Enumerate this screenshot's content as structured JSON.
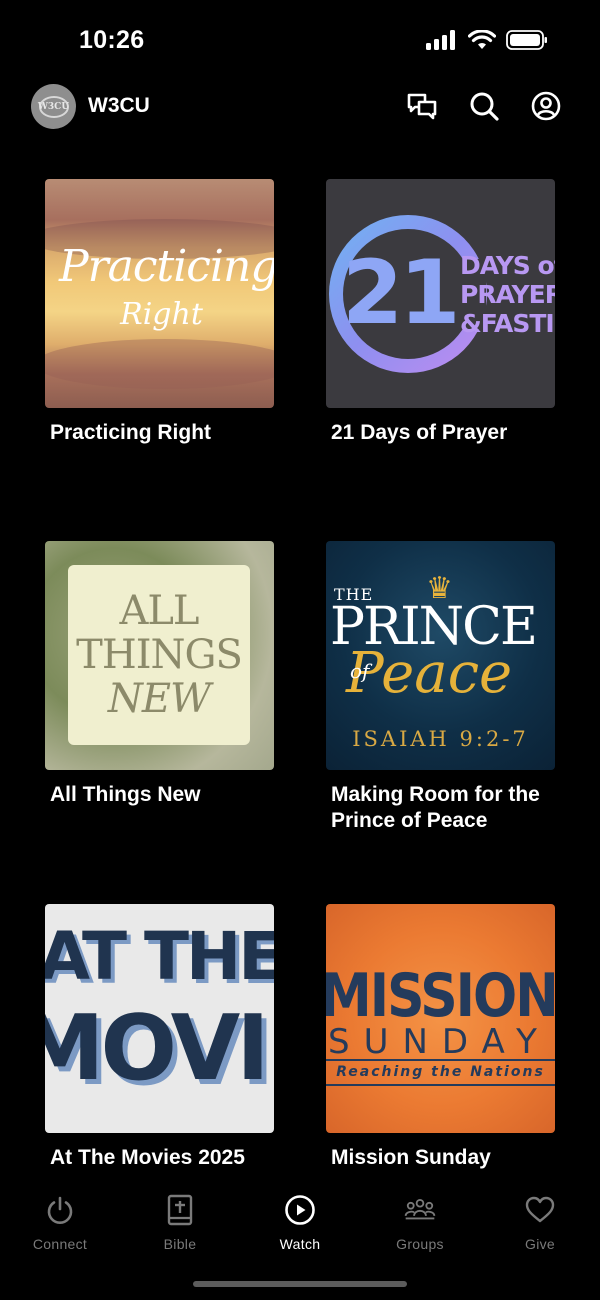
{
  "status_bar": {
    "time": "10:26"
  },
  "header": {
    "title": "W3CU",
    "avatar_text": "W3CU"
  },
  "series": [
    {
      "title": "Practicing Right",
      "art": {
        "line1": "Practicing",
        "line2": "Right"
      }
    },
    {
      "title": "21 Days of Prayer",
      "art": {
        "number": "21",
        "line1": "DAYS of",
        "line2": "PRAYER",
        "line3": "&FASTING"
      }
    },
    {
      "title": "All Things New",
      "art": {
        "line1": "ALL",
        "line2": "THINGS",
        "line3": "NEW"
      }
    },
    {
      "title": "Making Room for the Prince of Peace",
      "art": {
        "the": "THE",
        "prince": "PRINCE",
        "of": "of",
        "peace": "Peace",
        "ref": "ISAIAH 9:2-7"
      }
    },
    {
      "title": "At The Movies 2025",
      "art": {
        "line1": "AT THE",
        "line2": "MOVIES"
      }
    },
    {
      "title": "Mission Sunday",
      "art": {
        "line1": "MISSIONS",
        "line2": "SUNDAY",
        "line3": "Reaching the Nations"
      }
    }
  ],
  "tabs": [
    {
      "label": "Connect",
      "icon": "power-icon"
    },
    {
      "label": "Bible",
      "icon": "bible-icon"
    },
    {
      "label": "Watch",
      "icon": "play-icon",
      "active": true
    },
    {
      "label": "Groups",
      "icon": "groups-icon"
    },
    {
      "label": "Give",
      "icon": "heart-icon"
    }
  ]
}
